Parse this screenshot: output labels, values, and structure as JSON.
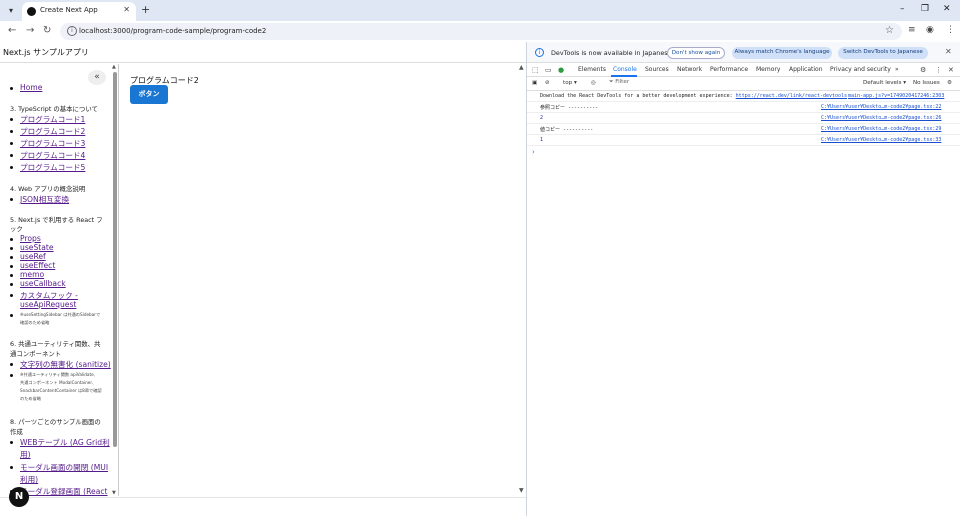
{
  "browser": {
    "tab_menu_icon": "chevron-down-icon",
    "tab_title": "Create Next App",
    "url": "localhost:3000/program-code-sample/program-code2",
    "window_controls": [
      "–",
      "❐",
      "✕"
    ]
  },
  "app": {
    "title": "Next.js サンプルアプリ",
    "collapse_label": "«",
    "home_link": "Home",
    "sections": [
      {
        "heading": "3. TypeScript の基本について",
        "links": [
          "プログラムコード1",
          "プログラムコード2",
          "プログラムコード3",
          "プログラムコード4",
          "プログラムコード5"
        ]
      },
      {
        "heading": "4. Web アプリの概念説明",
        "links": [
          "JSON相互変換"
        ]
      },
      {
        "heading_line1": "5. Next.js で利用する React フ",
        "heading_line2": "ック",
        "links": [
          "Props",
          "useState",
          "useRef",
          "useEffect",
          "memo",
          "useCallback"
        ],
        "multi_link_line1": "カスタムフック -",
        "multi_link_line2": "useApiRequest",
        "note_line1": "※useSettingSidebar は共通のSidebarで",
        "note_line2": "確認のため省略"
      },
      {
        "heading_line1": "6. 共通ユーティリティ関数、共",
        "heading_line2": "通コンポーネント",
        "links": [
          "文字列の無害化 (sanitize)"
        ],
        "note_line1": "※共通ユーティリティ関数 apiValidate、",
        "note_line2": "共通コンポーネント ModalContainer、",
        "note_line3": "SnackbarContentContainer は8章で確認",
        "note_line4": "のため省略"
      },
      {
        "heading_line1": "8. パーツごとのサンプル画面の",
        "heading_line2": "作成",
        "link1_line1": "WEBテーブル (AG Grid利",
        "link1_line2": "用)",
        "link2_line1": "モーダル画面の開閉 (MUI",
        "link2_line2": "利用)",
        "link3_line1": "モーダル登録画面 (React"
      }
    ],
    "main_heading": "プログラムコード2",
    "main_button": "ボタン",
    "next_badge": "N"
  },
  "devtools": {
    "banner_text": "DevTools is now available in Japanese",
    "dont_show": "Don't show again",
    "match_lang": "Always match Chrome's language",
    "switch_lang": "Switch DevTools to Japanese",
    "tabs": [
      "Elements",
      "Console",
      "Sources",
      "Network",
      "Performance",
      "Memory",
      "Application",
      "Privacy and security"
    ],
    "more_tabs": "»",
    "context": "top ▾",
    "filter_placeholder": "Filter",
    "levels": "Default levels ▾",
    "issues": "No Issues",
    "logs": [
      {
        "msg": "Download the React DevTools for a better development experience: ",
        "inline_link": "https://react.dev/link/react-devtools",
        "src": "main-app.js?v=1749020417246:2303"
      },
      {
        "msg": "参照コピー ----------",
        "src": "C:¥Users¥user¥Deskto…m-code2¥page.tsx:22"
      },
      {
        "msg": "2",
        "src": "C:¥Users¥user¥Deskto…m-code2¥page.tsx:26"
      },
      {
        "msg": "値コピー ----------",
        "src": "C:¥Users¥user¥Deskto…m-code2¥page.tsx:29"
      },
      {
        "msg": "1",
        "src": "C:¥Users¥user¥Deskto…m-code2¥page.tsx:33"
      }
    ],
    "prompt": "›"
  }
}
